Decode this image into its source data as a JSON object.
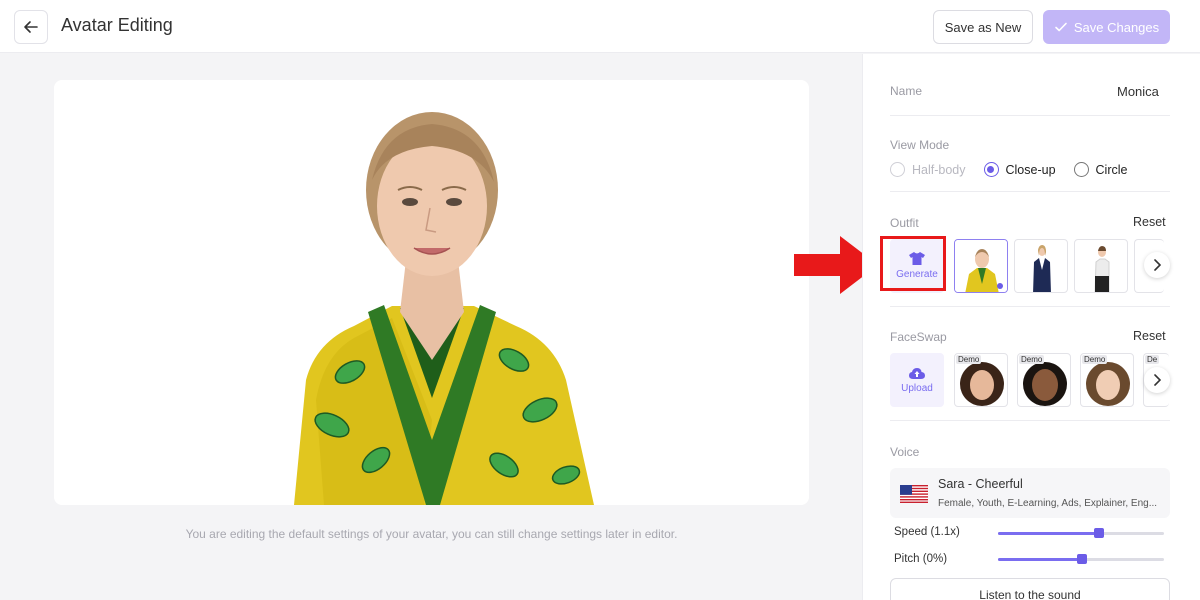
{
  "header": {
    "title": "Avatar Editing",
    "save_as_new": "Save as New",
    "save_changes": "Save Changes"
  },
  "editor": {
    "hint": "You are editing the default settings of your avatar, you can still change settings later in editor."
  },
  "panel": {
    "name": {
      "label": "Name",
      "value": "Monica"
    },
    "view_mode": {
      "label": "View Mode",
      "options": [
        "Half-body",
        "Close-up",
        "Circle"
      ],
      "selected": "Close-up"
    },
    "outfit": {
      "label": "Outfit",
      "reset": "Reset",
      "generate": "Generate"
    },
    "faceswap": {
      "label": "FaceSwap",
      "reset": "Reset",
      "upload": "Upload",
      "tags": [
        "Demo",
        "Demo",
        "Demo",
        "De"
      ]
    },
    "voice": {
      "label": "Voice",
      "name": "Sara - Cheerful",
      "description": "Female, Youth, E-Learning, Ads, Explainer, Eng...",
      "speed_label": "Speed (1.1x)",
      "speed_level": 0.6,
      "pitch_label": "Pitch (0%)",
      "pitch_level": 0.5,
      "listen": "Listen to the sound"
    }
  },
  "colors": {
    "accent": "#6b5ce7",
    "annotation": "#e8191a"
  }
}
